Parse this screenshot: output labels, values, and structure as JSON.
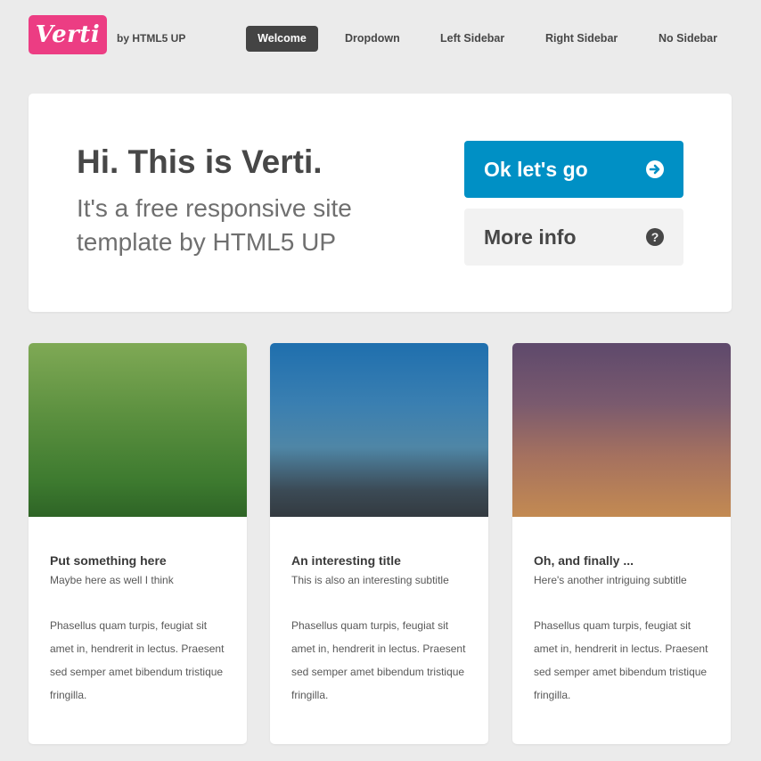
{
  "header": {
    "logo": "Verti",
    "byline": "by HTML5 UP",
    "nav": [
      {
        "label": "Welcome",
        "active": true
      },
      {
        "label": "Dropdown",
        "active": false
      },
      {
        "label": "Left Sidebar",
        "active": false
      },
      {
        "label": "Right Sidebar",
        "active": false
      },
      {
        "label": "No Sidebar",
        "active": false
      }
    ]
  },
  "banner": {
    "title": "Hi. This is Verti.",
    "subtitle": "It's a free responsive site template by HTML5 UP",
    "primary_button": {
      "label": "Ok let's go",
      "icon": "arrow-circle-right-icon"
    },
    "secondary_button": {
      "label": "More info",
      "icon": "question-circle-icon"
    }
  },
  "features": [
    {
      "title": "Put something here",
      "subtitle": "Maybe here as well I think",
      "text": "Phasellus quam turpis, feugiat sit amet in, hendrerit in lectus. Praesent sed semper amet bibendum tristique fringilla."
    },
    {
      "title": "An interesting title",
      "subtitle": "This is also an interesting subtitle",
      "text": "Phasellus quam turpis, feugiat sit amet in, hendrerit in lectus. Praesent sed semper amet bibendum tristique fringilla."
    },
    {
      "title": "Oh, and finally ...",
      "subtitle": "Here's another intriguing subtitle",
      "text": "Phasellus quam turpis, feugiat sit amet in, hendrerit in lectus. Praesent sed semper amet bibendum tristique fringilla."
    }
  ],
  "colors": {
    "background": "#ebebeb",
    "brand_pink": "#ec3d83",
    "primary_blue": "#0090c5",
    "nav_active": "#444444",
    "text": "#474747"
  }
}
